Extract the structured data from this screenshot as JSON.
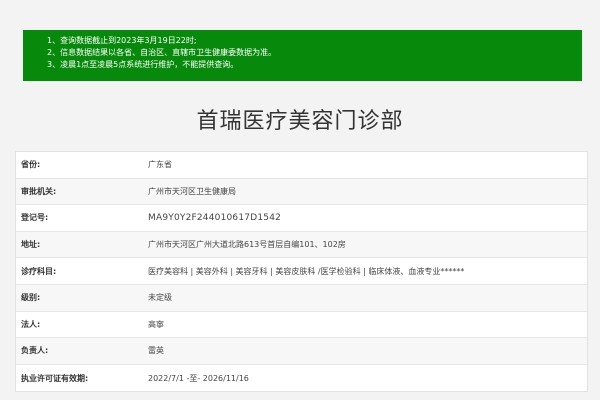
{
  "notice": {
    "lines": [
      "1、查询数据截止到2023年3月19日22时;",
      "2、信息数据结果以各省、自治区、直辖市卫生健康委数据为准。",
      "3、凌晨1点至凌晨5点系统进行维护，不能提供查询。"
    ]
  },
  "page_title": "首瑞医疗美容门诊部",
  "rows": [
    {
      "label": "省份:",
      "value": "广东省"
    },
    {
      "label": "审批机关:",
      "value": "广州市天河区卫生健康局"
    },
    {
      "label": "登记号:",
      "value": "MA9Y0Y2F244010617D1542"
    },
    {
      "label": "地址:",
      "value": "广州市天河区广州大道北路613号首层自编101、102房"
    },
    {
      "label": "诊疗科目:",
      "value": "医疗美容科 | 美容外科 | 美容牙科 | 美容皮肤科 /医学检验科 | 临床体液、血液专业******"
    },
    {
      "label": "级别:",
      "value": "未定级"
    },
    {
      "label": "法人:",
      "value": "高寧"
    },
    {
      "label": "负责人:",
      "value": "雷英"
    },
    {
      "label": "执业许可证有效期:",
      "value": "2022/7/1 -至- 2026/11/16"
    }
  ]
}
